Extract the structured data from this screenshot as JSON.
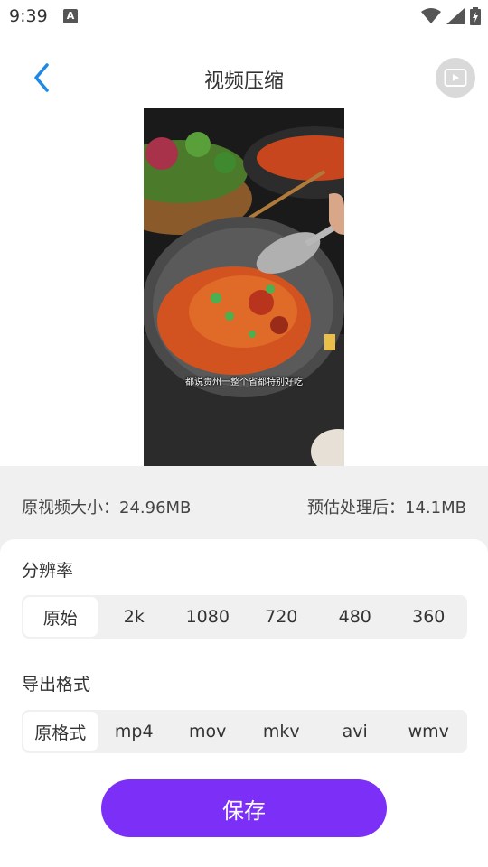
{
  "status": {
    "time": "9:39",
    "notif_letter": "A"
  },
  "header": {
    "title": "视频压缩",
    "back_icon": "chevron-left-icon",
    "action_icon": "play-video-icon"
  },
  "video": {
    "subtitle": "都说贵州一整个省都特别好吃"
  },
  "info": {
    "original_size": "原视频大小：24.96MB",
    "estimated_size": "预估处理后：14.1MB"
  },
  "resolution": {
    "label": "分辨率",
    "options": [
      "原始",
      "2k",
      "1080",
      "720",
      "480",
      "360"
    ],
    "selected": "原始"
  },
  "format": {
    "label": "导出格式",
    "options": [
      "原格式",
      "mp4",
      "mov",
      "mkv",
      "avi",
      "wmv"
    ],
    "selected": "原格式"
  },
  "save_label": "保存",
  "colors": {
    "accent": "#7b2ff7",
    "back_arrow": "#1e88e5",
    "panel_bg": "#f0f0f0"
  }
}
